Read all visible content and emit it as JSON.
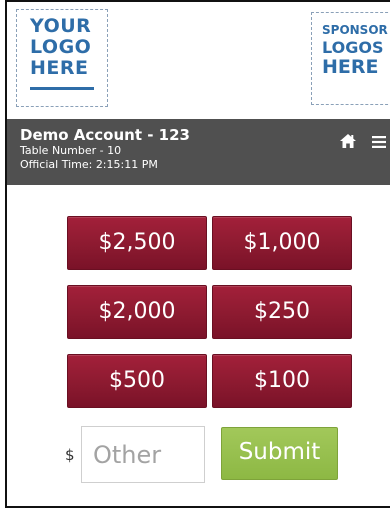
{
  "logos": {
    "left": [
      "YOUR",
      "LOGO",
      "HERE"
    ],
    "right": [
      "SPONSOR",
      "LOGOS",
      "HERE"
    ]
  },
  "account": {
    "name": "Demo Account - 123",
    "table": "Table Number - 10",
    "time": "Official Time: 2:15:11 PM"
  },
  "icons": {
    "home": "home-icon",
    "menu": "hamburger-menu-icon"
  },
  "amounts": [
    "$2,500",
    "$1,000",
    "$2,000",
    "$250",
    "$500",
    "$100"
  ],
  "other": {
    "currency_symbol": "$",
    "placeholder": "Other",
    "submit_label": "Submit"
  },
  "colors": {
    "amount_button": "#8c1a30",
    "submit_button": "#8db844",
    "account_bar": "#505050",
    "logo_blue": "#2e6da8"
  }
}
